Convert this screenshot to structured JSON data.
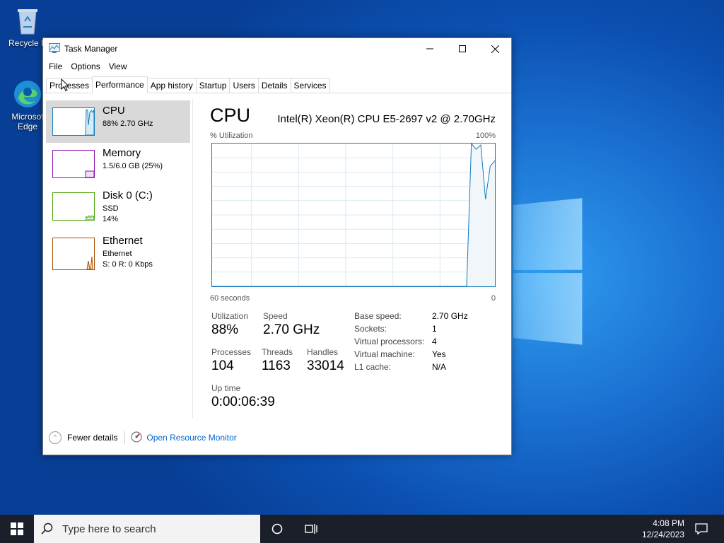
{
  "desktop": {
    "icons": [
      {
        "label": "Recycle B",
        "icon": "recycle-bin-icon"
      },
      {
        "label": "Microsof Edge",
        "icon": "edge-icon"
      }
    ]
  },
  "window": {
    "title": "Task Manager",
    "menu": [
      "File",
      "Options",
      "View"
    ],
    "tabs": [
      "Processes",
      "Performance",
      "App history",
      "Startup",
      "Users",
      "Details",
      "Services"
    ],
    "active_tab": "Performance"
  },
  "resources": [
    {
      "name": "CPU",
      "line2": "88% 2.70 GHz",
      "line3": "",
      "color": "#117dbb"
    },
    {
      "name": "Memory",
      "line2": "1.5/6.0 GB (25%)",
      "line3": "",
      "color": "#8b12ae"
    },
    {
      "name": "Disk 0 (C:)",
      "line2": "SSD",
      "line3": "14%",
      "color": "#4da60c"
    },
    {
      "name": "Ethernet",
      "line2": "Ethernet",
      "line3": "S: 0 R: 0 Kbps",
      "color": "#a74f01"
    }
  ],
  "detail": {
    "title": "CPU",
    "cpu_name": "Intel(R) Xeon(R) CPU E5-2697 v2 @ 2.70GHz",
    "y_label": "% Utilization",
    "y_max": "100%",
    "x_left": "60 seconds",
    "x_right": "0",
    "stats": {
      "utilization_label": "Utilization",
      "utilization": "88%",
      "speed_label": "Speed",
      "speed": "2.70 GHz",
      "processes_label": "Processes",
      "processes": "104",
      "threads_label": "Threads",
      "threads": "1163",
      "handles_label": "Handles",
      "handles": "33014",
      "uptime_label": "Up time",
      "uptime": "0:00:06:39"
    },
    "specs": [
      {
        "k": "Base speed:",
        "v": "2.70 GHz"
      },
      {
        "k": "Sockets:",
        "v": "1"
      },
      {
        "k": "Virtual processors:",
        "v": "4"
      },
      {
        "k": "Virtual machine:",
        "v": "Yes"
      },
      {
        "k": "L1 cache:",
        "v": "N/A"
      }
    ]
  },
  "chart_data": {
    "type": "area",
    "x": [
      60,
      59,
      58,
      57,
      56,
      55,
      54,
      53,
      52,
      51,
      50,
      49,
      48,
      47,
      46,
      45,
      44,
      43,
      42,
      41,
      40,
      39,
      38,
      37,
      36,
      35,
      34,
      33,
      32,
      31,
      30,
      29,
      28,
      27,
      26,
      25,
      24,
      23,
      22,
      21,
      20,
      19,
      18,
      17,
      16,
      15,
      14,
      13,
      12,
      11,
      10,
      9,
      8,
      7,
      6,
      5,
      4,
      3,
      2,
      1,
      0
    ],
    "values": [
      0,
      0,
      0,
      0,
      0,
      0,
      0,
      0,
      0,
      0,
      0,
      0,
      0,
      0,
      0,
      0,
      0,
      0,
      0,
      0,
      0,
      0,
      0,
      0,
      0,
      0,
      0,
      0,
      0,
      0,
      0,
      0,
      0,
      0,
      0,
      0,
      0,
      0,
      0,
      0,
      0,
      0,
      0,
      0,
      0,
      0,
      0,
      0,
      0,
      0,
      0,
      0,
      0,
      0,
      0,
      100,
      96,
      99,
      61,
      84,
      88
    ],
    "xlabel": "60 seconds",
    "ylabel": "% Utilization",
    "ylim": [
      0,
      100
    ]
  },
  "footer": {
    "fewer_details": "Fewer details",
    "open_resource_monitor": "Open Resource Monitor"
  },
  "taskbar": {
    "search_placeholder": "Type here to search",
    "time": "4:08 PM",
    "date": "12/24/2023"
  }
}
